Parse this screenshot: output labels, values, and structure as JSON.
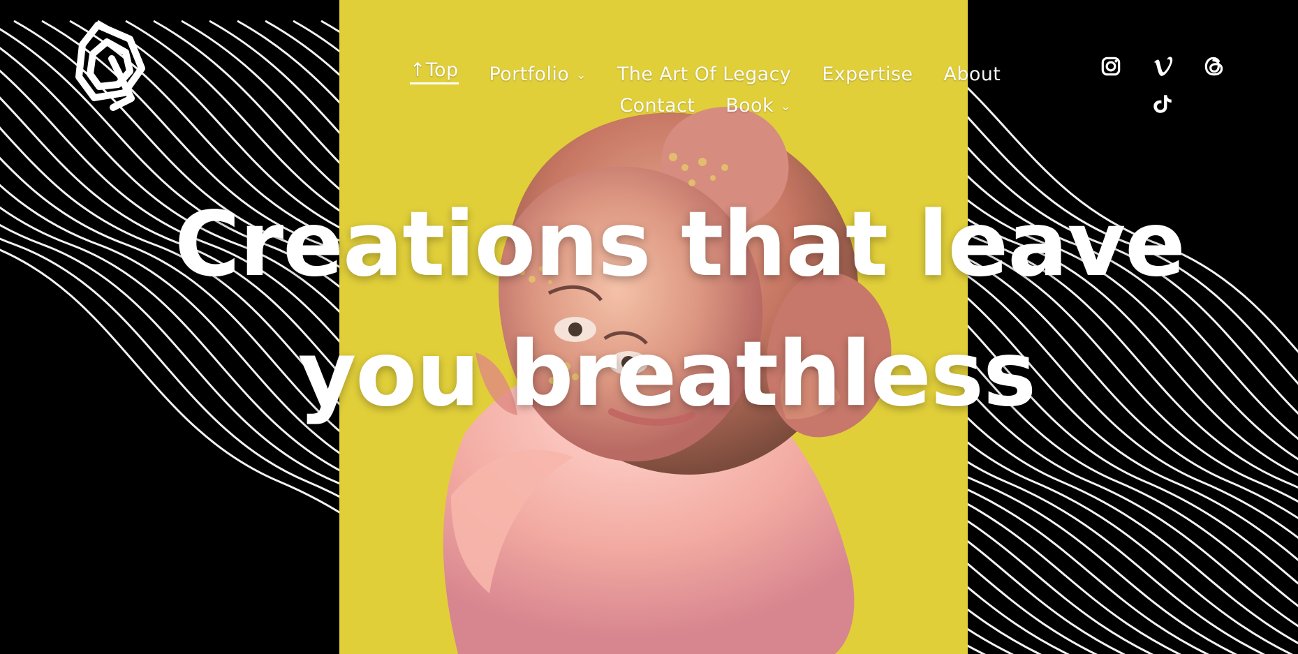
{
  "nav": {
    "items": [
      {
        "label": "↑Top",
        "active": true
      },
      {
        "label": "Portfolio",
        "dropdown": true
      },
      {
        "label": "The Art Of Legacy"
      },
      {
        "label": "Expertise"
      },
      {
        "label": "About"
      },
      {
        "label": "Contact"
      },
      {
        "label": "Book",
        "dropdown": true
      }
    ],
    "caret": "⌄"
  },
  "social": [
    {
      "name": "instagram-icon"
    },
    {
      "name": "vimeo-icon"
    },
    {
      "name": "threads-icon"
    },
    {
      "name": "tiktok-icon"
    }
  ],
  "hero": {
    "headline_line_1": "Creations that leave",
    "headline_line_2": "you breathless"
  },
  "colors": {
    "background": "#000000",
    "photo_yellow": "#e1cf3a",
    "text": "#ffffff"
  }
}
